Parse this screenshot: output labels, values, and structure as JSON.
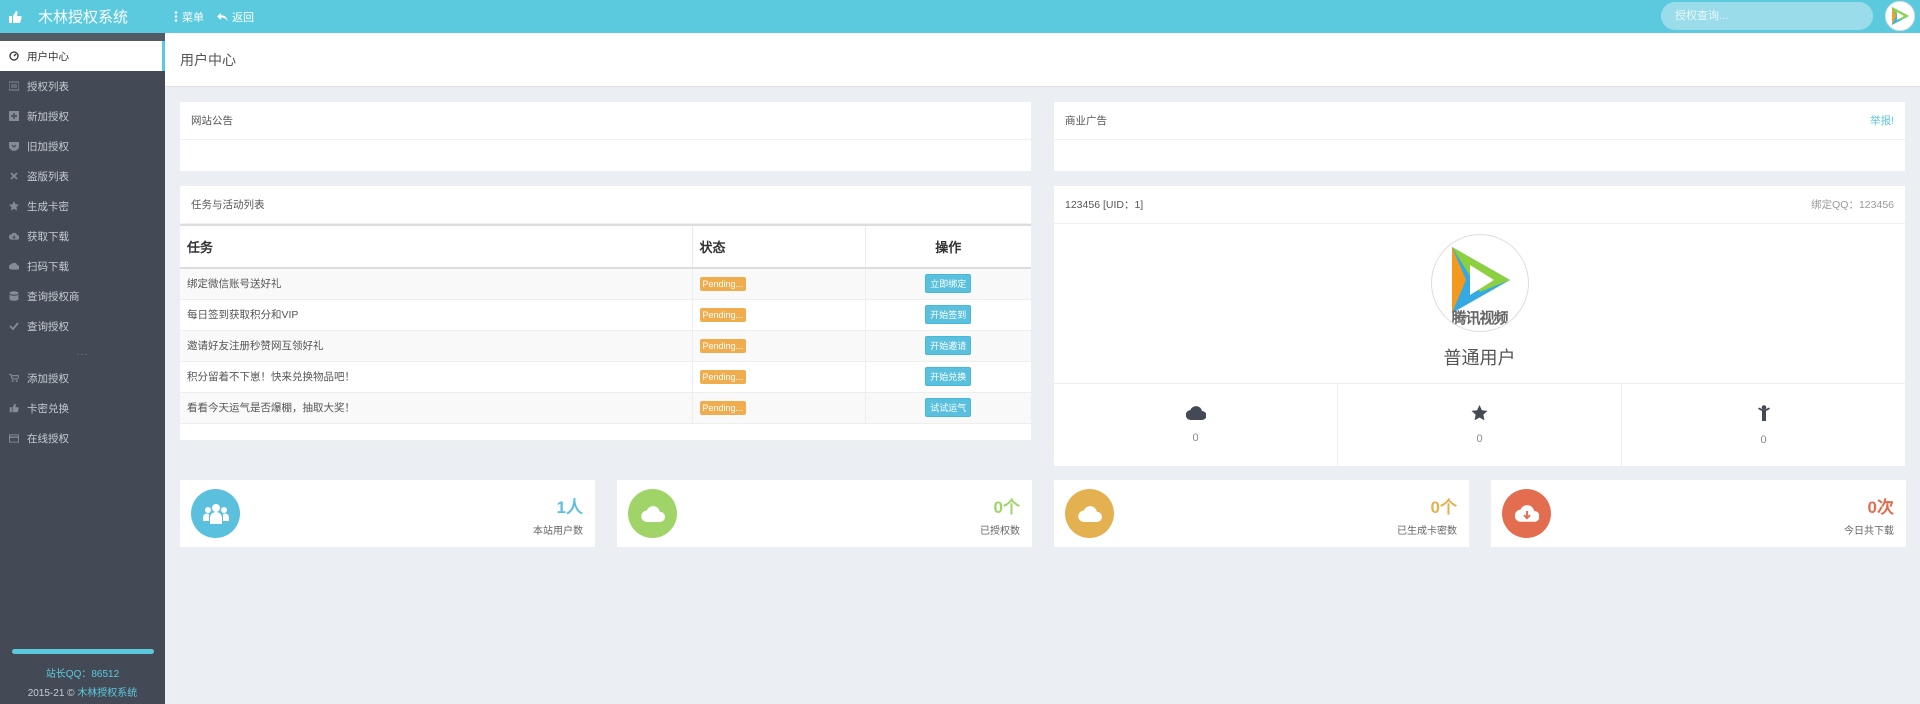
{
  "app": {
    "title": "木林授权系统"
  },
  "topnav": {
    "menu": "菜单",
    "back": "返回"
  },
  "search": {
    "placeholder": "授权查询..."
  },
  "sidebar": {
    "items": [
      {
        "label": "用户中心",
        "icon": "dashboard-icon",
        "active": true
      },
      {
        "label": "授权列表",
        "icon": "list-icon"
      },
      {
        "label": "新加授权",
        "icon": "plus-square-icon"
      },
      {
        "label": "旧加授权",
        "icon": "pocket-icon"
      },
      {
        "label": "盗版列表",
        "icon": "close-icon"
      },
      {
        "label": "生成卡密",
        "icon": "star-icon"
      },
      {
        "label": "获取下载",
        "icon": "cloud-download-icon"
      },
      {
        "label": "扫码下载",
        "icon": "cloud-icon"
      },
      {
        "label": "查询授权商",
        "icon": "database-icon"
      },
      {
        "label": "查询授权",
        "icon": "check-icon"
      }
    ],
    "separator": "...",
    "items2": [
      {
        "label": "添加授权",
        "icon": "cart-icon"
      },
      {
        "label": "卡密兑换",
        "icon": "thumbs-up-icon"
      },
      {
        "label": "在线授权",
        "icon": "credit-card-icon"
      }
    ],
    "footer": {
      "qq": "站长QQ：86512",
      "copy_prefix": "2015-21 © ",
      "copy_brand": "木林授权系统"
    }
  },
  "page": {
    "title": "用户中心"
  },
  "notice": {
    "title": "网站公告"
  },
  "ads": {
    "title": "商业广告",
    "report": "举报!"
  },
  "tasks": {
    "title": "任务与活动列表",
    "headers": [
      "任务",
      "状态",
      "操作"
    ],
    "rows": [
      {
        "task": "绑定微信账号送好礼",
        "status": "Pending...",
        "action": "立即绑定"
      },
      {
        "task": "每日签到获取积分和VIP",
        "status": "Pending...",
        "action": "开始签到"
      },
      {
        "task": "邀请好友注册秒赞网互领好礼",
        "status": "Pending...",
        "action": "开始邀请"
      },
      {
        "task": "积分留着不下崽！快来兑换物品吧！",
        "status": "Pending...",
        "action": "开始兑换"
      },
      {
        "task": "看看今天运气是否爆棚，抽取大奖！",
        "status": "Pending...",
        "action": "试试运气"
      }
    ]
  },
  "profile": {
    "id_line": "123456 [UID：1]",
    "qq": "绑定QQ：123456",
    "avatar_text": "腾讯视频",
    "role": "普通用户",
    "stats": [
      {
        "icon": "cloud-icon",
        "value": "0"
      },
      {
        "icon": "star-icon",
        "value": "0"
      },
      {
        "icon": "person-icon",
        "value": "0"
      }
    ]
  },
  "cards": [
    {
      "value": "1人",
      "label": "本站用户数",
      "icon": "users-icon",
      "color": "#5bc0de"
    },
    {
      "value": "0个",
      "label": "已授权数",
      "icon": "cloud-icon",
      "color": "#a0d468"
    },
    {
      "value": "0个",
      "label": "已生成卡密数",
      "icon": "cloud-icon",
      "color": "#e3b14f"
    },
    {
      "value": "0次",
      "label": "今日共下载",
      "icon": "cloud-download-icon",
      "color": "#e36d4f"
    }
  ]
}
